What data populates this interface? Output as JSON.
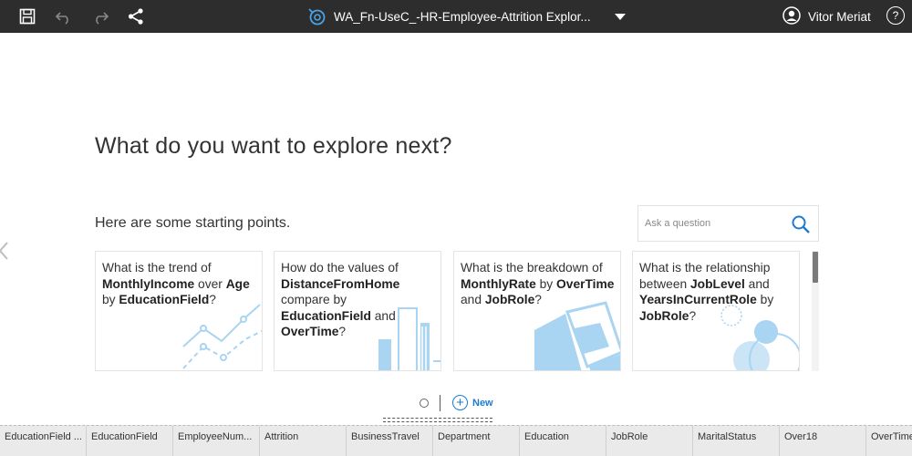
{
  "topbar": {
    "title": "WA_Fn-UseC_-HR-Employee-Attrition Explor...",
    "user_name": "Vitor Meriat",
    "help_label": "?"
  },
  "main": {
    "heading": "What do you want to explore next?",
    "subheading": "Here are some starting points.",
    "search_placeholder": "Ask a question"
  },
  "cards": [
    {
      "parts": [
        [
          "What is the trend of ",
          false
        ],
        [
          "MonthlyIncome",
          true
        ],
        [
          " over ",
          false
        ],
        [
          "Age",
          true
        ],
        [
          " by ",
          false
        ],
        [
          "EducationField",
          true
        ],
        [
          "?",
          false
        ]
      ]
    },
    {
      "parts": [
        [
          "How do the values of ",
          false
        ],
        [
          "DistanceFromHome",
          true
        ],
        [
          " compare by ",
          false
        ],
        [
          "EducationField",
          true
        ],
        [
          " and ",
          false
        ],
        [
          "OverTime",
          true
        ],
        [
          "?",
          false
        ]
      ]
    },
    {
      "parts": [
        [
          "What is the breakdown of ",
          false
        ],
        [
          "MonthlyRate",
          true
        ],
        [
          " by ",
          false
        ],
        [
          "OverTime",
          true
        ],
        [
          " and ",
          false
        ],
        [
          "JobRole",
          true
        ],
        [
          "?",
          false
        ]
      ]
    },
    {
      "parts": [
        [
          "What is the relationship between ",
          false
        ],
        [
          "JobLevel",
          true
        ],
        [
          " and ",
          false
        ],
        [
          "YearsInCurrentRole",
          true
        ],
        [
          " by ",
          false
        ],
        [
          "JobRole",
          true
        ],
        [
          "?",
          false
        ]
      ]
    }
  ],
  "pager": {
    "new_label": "New"
  },
  "columns": [
    "EducationField ...",
    "EducationField",
    "EmployeeNum...",
    "Attrition",
    "BusinessTravel",
    "Department",
    "Education",
    "JobRole",
    "MaritalStatus",
    "Over18",
    "OverTime"
  ],
  "colors": {
    "topbar_bg": "#2d2d2d",
    "accent": "#1c7bd0",
    "illustration": "#a9d4f2"
  }
}
